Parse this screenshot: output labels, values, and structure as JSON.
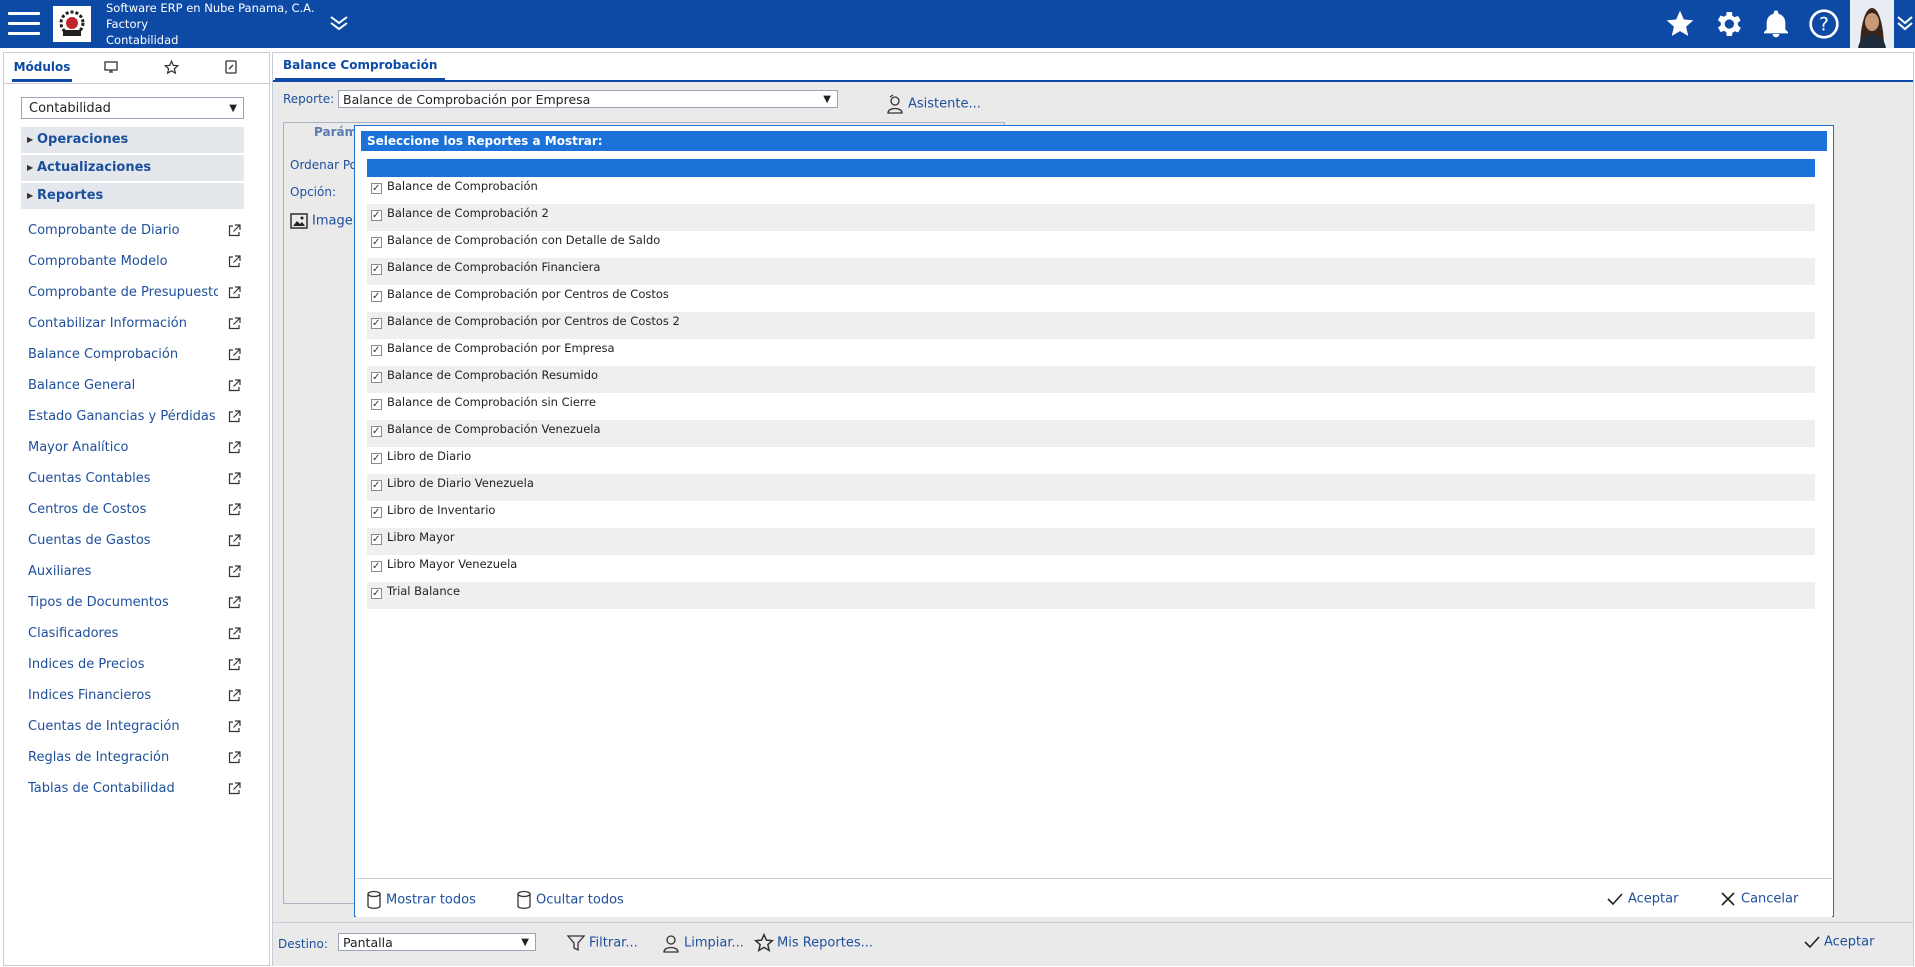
{
  "header": {
    "company_line1": "Software ERP en Nube Panama, C.A.",
    "company_line2": "Factory",
    "company_line3": "Contabilidad"
  },
  "sidebar": {
    "module_value": "Contabilidad",
    "sections": [
      "Operaciones",
      "Actualizaciones",
      "Reportes"
    ],
    "items": [
      "Comprobante de Diario",
      "Comprobante Modelo",
      "Comprobante de Presupuesto",
      "Contabilizar Información",
      "Balance Comprobación",
      "Balance General",
      "Estado Ganancias y Pérdidas",
      "Mayor Analítico",
      "Cuentas Contables",
      "Centros de Costos",
      "Cuentas de Gastos",
      "Auxiliares",
      "Tipos de Documentos",
      "Clasificadores",
      "Indices de Precios",
      "Indices Financieros",
      "Cuentas de Integración",
      "Reglas de Integración",
      "Tablas de Contabilidad"
    ],
    "tabs": {
      "modulos": "Módulos"
    }
  },
  "main": {
    "tab_label": "Balance Comprobación",
    "reporte_label": "Reporte:",
    "reporte_value": "Balance de Comprobación por Empresa",
    "asistente_label": "Asistente...",
    "param_tab": "Parám",
    "ordenar_label": "Ordenar Por",
    "opcion_label": "Opción:",
    "imagen_label": "Imagen",
    "destino_label": "Destino:",
    "destino_value": "Pantalla",
    "filtrar_label": "Filtrar...",
    "limpiar_label": "Limpiar...",
    "mis_reportes_label": "Mis Reportes...",
    "aceptar_label": "Aceptar"
  },
  "modal": {
    "title": "Seleccione los Reportes a Mostrar:",
    "reports": [
      "Balance de Comprobación",
      "Balance de Comprobación 2",
      "Balance de Comprobación con Detalle de Saldo",
      "Balance de Comprobación Financiera",
      "Balance de Comprobación por Centros de Costos",
      "Balance de Comprobación por Centros de Costos 2",
      "Balance de Comprobación por Empresa",
      "Balance de Comprobación Resumido",
      "Balance de Comprobación sin Cierre",
      "Balance de Comprobación Venezuela",
      "Libro de Diario",
      "Libro de Diario Venezuela",
      "Libro de Inventario",
      "Libro Mayor",
      "Libro Mayor Venezuela",
      "Trial Balance"
    ],
    "mostrar_todos": "Mostrar todos",
    "ocultar_todos": "Ocultar todos",
    "aceptar": "Aceptar",
    "cancelar": "Cancelar"
  },
  "colors": {
    "header_blue": "#0d4aa6",
    "modal_blue": "#1b72d8",
    "link_blue": "#1e4f9a"
  }
}
